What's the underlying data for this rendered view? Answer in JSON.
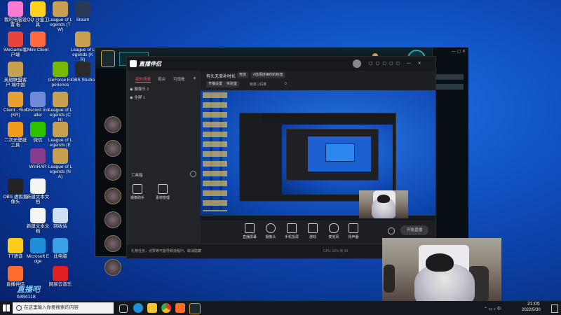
{
  "desktop": {
    "icons": [
      {
        "label": "我的电脑设置\n板",
        "color": "#ff7ad1"
      },
      {
        "label": "QQ 沙盒工\n具",
        "color": "#ffd21e"
      },
      {
        "label": "League of\nLegends (TW)",
        "color": "#c8a050"
      },
      {
        "label": "Steam",
        "color": "#2a3a55"
      },
      {
        "label": "WeGame客\n户端",
        "color": "#e7443c"
      },
      {
        "label": "Mini Client",
        "color": "#ff6a3c"
      },
      {
        "label": "League of\nLegends (KR)",
        "color": "#c8a050"
      },
      {
        "label": "英雄联盟客户\n端中国",
        "color": "#c8a050"
      },
      {
        "label": "GeForce\nExperience",
        "color": "#76b900"
      },
      {
        "label": "OBS Studio",
        "color": "#2a2a2a"
      },
      {
        "label": "Client - Run\n(KR)",
        "color": "#e8a030"
      },
      {
        "label": "Discord\nInstaller",
        "color": "#7289da"
      },
      {
        "label": "League of\nLegends (CN)",
        "color": "#c8a050"
      },
      {
        "label": "二次元壁纸\n工具",
        "color": "#f29b1d"
      },
      {
        "label": "微信",
        "color": "#2dc100"
      },
      {
        "label": "League of\nLegends (EU)",
        "color": "#c8a050"
      },
      {
        "label": "WinRAR",
        "color": "#8a3a8a"
      },
      {
        "label": "League of\nLegends (NA)",
        "color": "#c8a050"
      },
      {
        "label": "OBS 虚拟摄\n像头",
        "color": "#222"
      },
      {
        "label": "新建文本文\n档",
        "color": "#f5f5f5"
      },
      {
        "label": "新建文本文\n档",
        "color": "#f5f5f5"
      },
      {
        "label": "回收站",
        "color": "#cfe0f5"
      },
      {
        "label": "TT语音",
        "color": "#ffcc1e"
      },
      {
        "label": "Microsoft\nEdge",
        "color": "#1e8fd6"
      },
      {
        "label": "此电脑",
        "color": "#3aa0e8"
      },
      {
        "label": "直播伴侣",
        "color": "#ff6b2a"
      },
      {
        "label": "网易云音乐",
        "color": "#e02020"
      }
    ]
  },
  "stream_app": {
    "logo": "直播伴侣",
    "left_tabs": [
      "我的场景",
      "观众",
      "可观看"
    ],
    "scenes": [
      "摄像头 1",
      "全屏 1"
    ],
    "right_header": {
      "title": "有头无单补时长",
      "tag1": "竞技",
      "tag2": "#选择连接你的标签",
      "line2_a": "开播设置",
      "line2_b": "实验室",
      "line2_c": "帧率 | 码率",
      "counter": "0"
    },
    "side_tools_title": "工具箱",
    "side_tools": [
      "摄像助手",
      "素材管理"
    ],
    "bottom_tools": [
      "直播屏幕",
      "摄像头",
      "手机投屏",
      "游戏",
      "麦克风",
      "扬声器"
    ],
    "start_button": "开始直播",
    "status_text": "礼物任务，点赞等可能导致流程中，取消隐藏",
    "status_right": "CPU 16%  帧 60"
  },
  "watermark": {
    "brand": "直播吧",
    "id": "6384118"
  },
  "taskbar": {
    "search_placeholder": "在这里输入你要搜索的内容",
    "time": "21:05",
    "date": "2022/5/30"
  }
}
